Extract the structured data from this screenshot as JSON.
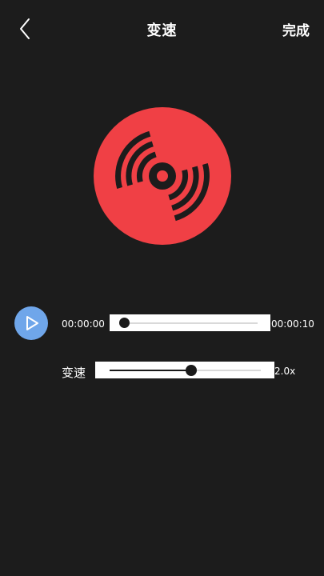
{
  "header": {
    "back_icon": "chevron-left-icon",
    "title": "变速",
    "done_label": "完成"
  },
  "artwork": {
    "icon": "vinyl-disc-icon",
    "color": "#f04045"
  },
  "player": {
    "play_icon": "play-icon",
    "play_button_color": "#6fa6ea",
    "current_time": "00:00:00",
    "total_time": "00:00:10",
    "progress": 0.0
  },
  "speed": {
    "label": "变速",
    "value_label": "2.0x",
    "position": 0.54
  }
}
